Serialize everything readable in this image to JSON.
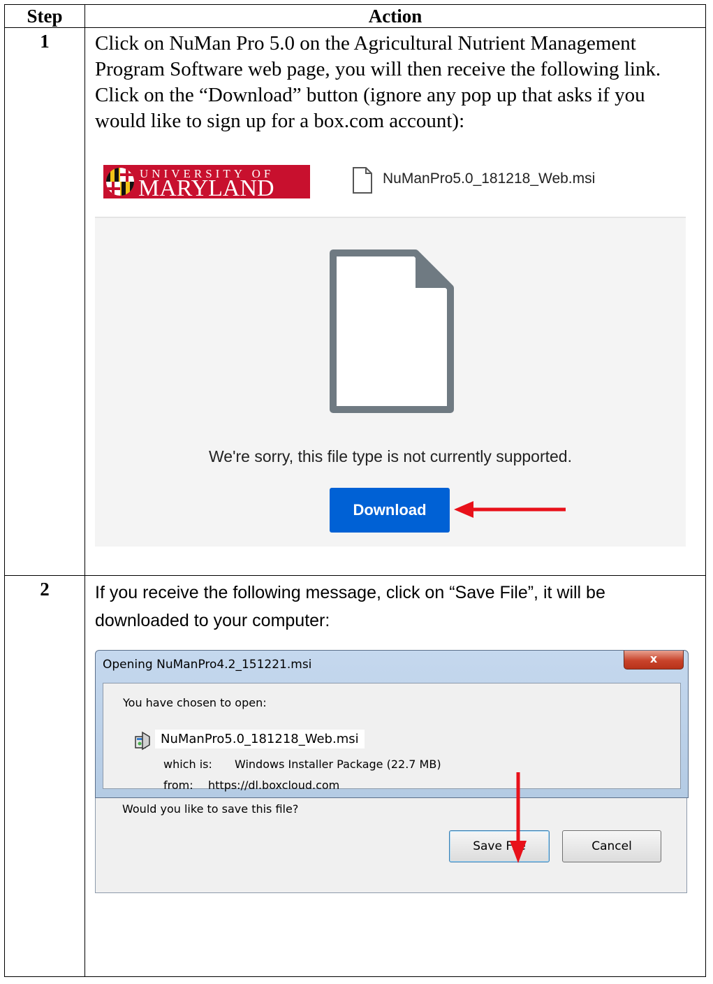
{
  "table": {
    "header_step": "Step",
    "header_action": "Action"
  },
  "steps": [
    {
      "number": "1",
      "text": "Click on NuMan Pro 5.0 on the Agricultural Nutrient Management Program Software web page, you will then receive the following link. Click on the “Download” button (ignore any pop up that asks if you would like to sign up for a box.com account):"
    },
    {
      "number": "2",
      "text": "If you receive the following message, click on “Save File”, it will be downloaded to your computer:"
    }
  ],
  "box_viewer": {
    "logo_line1": "UNIVERSITY OF",
    "logo_line2": "MARYLAND",
    "file_name": "NuManPro5.0_181218_Web.msi",
    "message": "We're sorry, this file type is not currently supported.",
    "download_label": "Download",
    "button_color": "#0061d5"
  },
  "dialog": {
    "title": "Opening NuManPro4.2_151221.msi",
    "close_label": "x",
    "chosen_label": "You have chosen to open:",
    "file_name": "NuManPro5.0_181218_Web.msi",
    "which_is_label": "which is:",
    "which_is_value": "Windows Installer Package (22.7 MB)",
    "from_label": "from:",
    "from_value": "https://dl.boxcloud.com",
    "question": "Would you like to save this file?",
    "save_label": "Save File",
    "cancel_label": "Cancel"
  },
  "annotation_color": "#e8111a"
}
